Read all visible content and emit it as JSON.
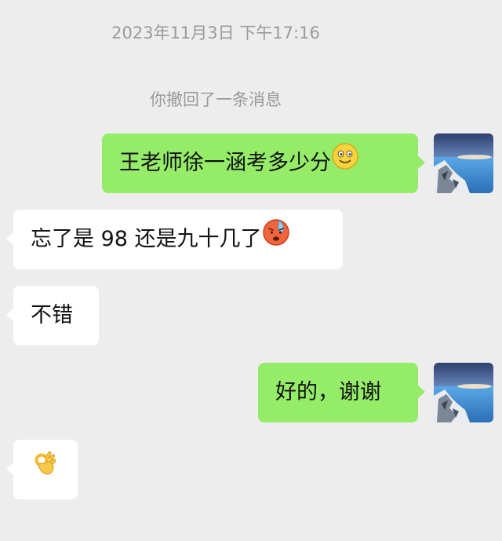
{
  "timestamp": "2023年11月3日 下午17:16",
  "recall_notice": "你撤回了一条消息",
  "messages": [
    {
      "direction": "sent",
      "text": "王老师徐一涵考多少分",
      "emoji": "slightly-smiling-face-icon"
    },
    {
      "direction": "received",
      "text": "忘了是 98 还是九十几了",
      "emoji": "cold-sweat-face-icon"
    },
    {
      "direction": "received",
      "text": "不错"
    },
    {
      "direction": "sent",
      "text": "好的，谢谢"
    },
    {
      "direction": "received",
      "text": "",
      "emoji": "ok-hand-icon"
    }
  ],
  "colors": {
    "background": "#ededed",
    "sent_bubble": "#95ec69",
    "received_bubble": "#ffffff",
    "system_text": "#9a9a9a"
  }
}
